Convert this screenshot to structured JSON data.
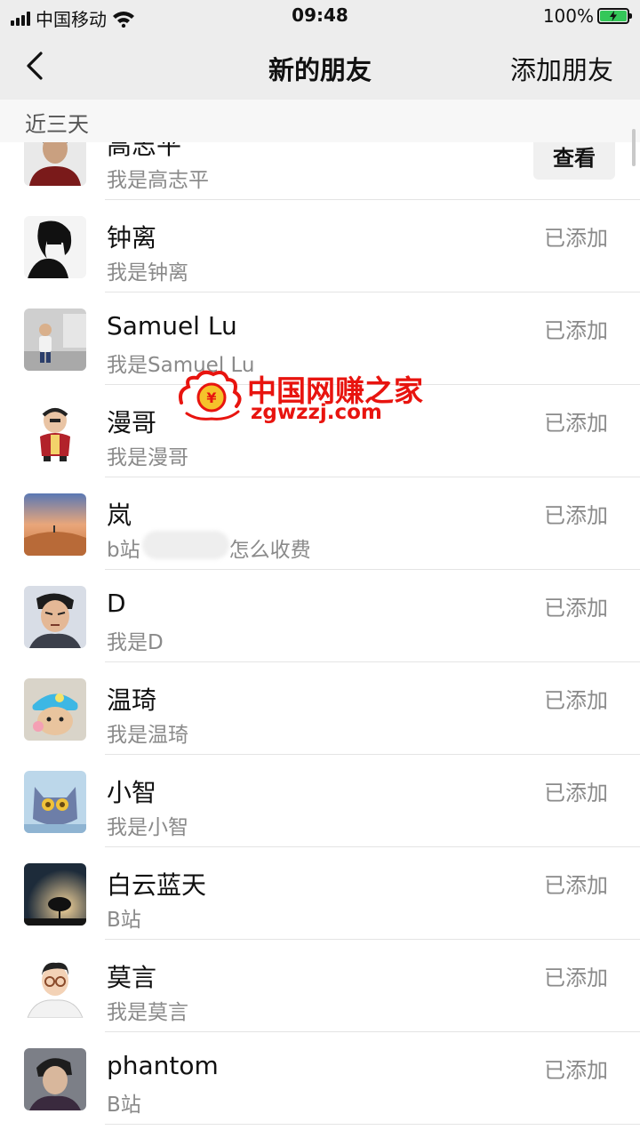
{
  "status_bar": {
    "carrier": "中国移动",
    "time": "09:48",
    "battery": "100%"
  },
  "nav": {
    "title": "新的朋友",
    "action": "添加朋友"
  },
  "section": {
    "label": "近三天"
  },
  "contacts": [
    {
      "name": "高志平",
      "subtitle": "我是高志平",
      "status": "",
      "button": "查看"
    },
    {
      "name": "钟离",
      "subtitle": "我是钟离",
      "status": "已添加"
    },
    {
      "name": "Samuel Lu",
      "subtitle": "我是Samuel Lu",
      "status": "已添加"
    },
    {
      "name": "漫哥",
      "subtitle": "我是漫哥",
      "status": "已添加"
    },
    {
      "name": "岚",
      "subtitle": "b站",
      "subtitle_tail": "怎么收费",
      "status": "已添加"
    },
    {
      "name": "D",
      "subtitle": "我是D",
      "status": "已添加"
    },
    {
      "name": "温琦",
      "subtitle": "我是温琦",
      "status": "已添加"
    },
    {
      "name": "小智",
      "subtitle": "我是小智",
      "status": "已添加"
    },
    {
      "name": "白云蓝天",
      "subtitle": "B站",
      "status": "已添加"
    },
    {
      "name": "莫言",
      "subtitle": "我是莫言",
      "status": "已添加"
    },
    {
      "name": "phantom",
      "subtitle": "B站",
      "status": "已添加"
    }
  ],
  "watermark": {
    "text": "中国网赚之家",
    "url": "zgwzzj.com"
  },
  "colors": {
    "nav_bg": "#ededed",
    "section_bg": "#f7f7f7",
    "secondary_text": "#8a8a8a",
    "battery_green": "#34c759",
    "watermark_red": "#e8140f"
  }
}
